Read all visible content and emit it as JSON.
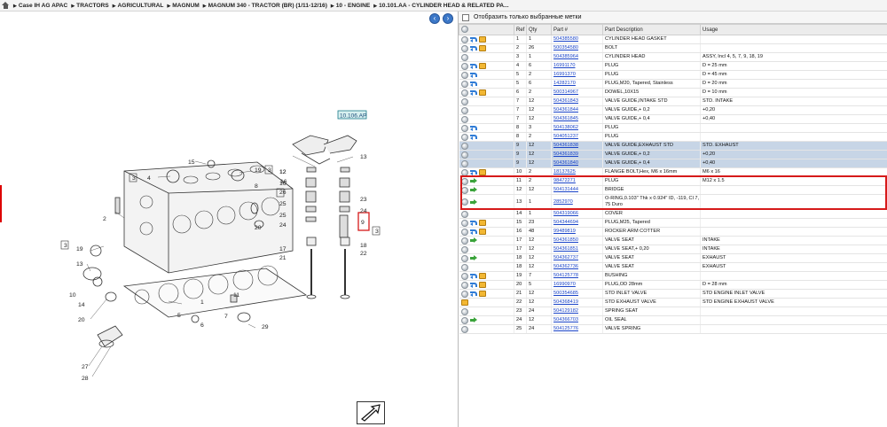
{
  "breadcrumb": [
    "Case IH AG APAC",
    "TRACTORS",
    "AGRICULTURAL",
    "MAGNUM",
    "MAGNUM 340 - TRACTOR (BR) (1/11-12/16)",
    "10 - ENGINE",
    "10.101.AA - CYLINDER HEAD & RELATED PA..."
  ],
  "toolbar": {
    "prev_icon": "left-arrow-icon",
    "next_icon": "right-arrow-icon"
  },
  "filter": {
    "label": "Отобразить только выбранные метки",
    "checked": false
  },
  "table": {
    "columns": [
      "",
      "Ref",
      "Qty",
      "Part #",
      "Part Description",
      "Usage"
    ],
    "rows": [
      {
        "icons": [
          "circle",
          "blue",
          "box"
        ],
        "ref": "1",
        "qty": "1",
        "part": "504385580",
        "desc": "CYLINDER HEAD GASKET",
        "usage": "",
        "selected": false
      },
      {
        "icons": [
          "circle",
          "blue",
          "box"
        ],
        "ref": "2",
        "qty": "26",
        "part": "500354580",
        "desc": "BOLT",
        "usage": "",
        "selected": false
      },
      {
        "icons": [
          "circle"
        ],
        "ref": "3",
        "qty": "1",
        "part": "504385964",
        "desc": "CYLINDER HEAD",
        "usage": "ASSY, Incl 4, 5, 7, 9, 18, 19",
        "selected": false
      },
      {
        "icons": [
          "circle",
          "blue",
          "box"
        ],
        "ref": "4",
        "qty": "6",
        "part": "16991170",
        "desc": "PLUG",
        "usage": "D = 25 mm",
        "selected": false
      },
      {
        "icons": [
          "circle",
          "blue"
        ],
        "ref": "5",
        "qty": "2",
        "part": "16991370",
        "desc": "PLUG",
        "usage": "D = 45 mm",
        "selected": false
      },
      {
        "icons": [
          "circle",
          "blue"
        ],
        "ref": "5",
        "qty": "6",
        "part": "14282170",
        "desc": "PLUG,M20, Tapered, Stainless",
        "usage": "D = 20 mm",
        "selected": false
      },
      {
        "icons": [
          "circle",
          "blue",
          "box"
        ],
        "ref": "6",
        "qty": "2",
        "part": "500314967",
        "desc": "DOWEL,10X15",
        "usage": "D = 10 mm",
        "selected": false
      },
      {
        "icons": [
          "circle"
        ],
        "ref": "7",
        "qty": "12",
        "part": "504361843",
        "desc": "VALVE GUIDE,INTAKE STD",
        "usage": "STD. INTAKE",
        "selected": false
      },
      {
        "icons": [
          "circle"
        ],
        "ref": "7",
        "qty": "12",
        "part": "504361844",
        "desc": "VALVE GUIDE,+ 0,2",
        "usage": "+0,20",
        "selected": false
      },
      {
        "icons": [
          "circle"
        ],
        "ref": "7",
        "qty": "12",
        "part": "504361845",
        "desc": "VALVE GUIDE,+ 0,4",
        "usage": "+0,40",
        "selected": false
      },
      {
        "icons": [
          "circle",
          "blue"
        ],
        "ref": "8",
        "qty": "3",
        "part": "504138062",
        "desc": "PLUG",
        "usage": "",
        "selected": false
      },
      {
        "icons": [
          "circle",
          "blue"
        ],
        "ref": "8",
        "qty": "2",
        "part": "504051237",
        "desc": "PLUG",
        "usage": "",
        "selected": false
      },
      {
        "icons": [
          "circle"
        ],
        "ref": "9",
        "qty": "12",
        "part": "504361838",
        "desc": "VALVE GUIDE,EXHAUST STD",
        "usage": "STD. EXHAUST",
        "selected": true
      },
      {
        "icons": [
          "circle"
        ],
        "ref": "9",
        "qty": "12",
        "part": "504361839",
        "desc": "VALVE GUIDE,+ 0,2",
        "usage": "+0,20",
        "selected": true
      },
      {
        "icons": [
          "circle"
        ],
        "ref": "9",
        "qty": "12",
        "part": "504361840",
        "desc": "VALVE GUIDE,+ 0,4",
        "usage": "+0,40",
        "selected": true
      },
      {
        "icons": [
          "circle",
          "blue",
          "box"
        ],
        "ref": "10",
        "qty": "2",
        "part": "18137625",
        "desc": "FLANGE BOLT,Hex, M6 x 16mm",
        "usage": "M6 x 16",
        "selected": false
      },
      {
        "icons": [
          "circle",
          "green"
        ],
        "ref": "11",
        "qty": "2",
        "part": "98472271",
        "desc": "PLUG",
        "usage": "M12 x 1.5",
        "selected": false
      },
      {
        "icons": [
          "circle",
          "green"
        ],
        "ref": "12",
        "qty": "12",
        "part": "504131444",
        "desc": "BRIDGE",
        "usage": "",
        "selected": false
      },
      {
        "icons": [
          "circle",
          "green"
        ],
        "ref": "13",
        "qty": "1",
        "part": "2852970",
        "desc": "O-RING,0.103\" Thk x 0.924\" ID, -119, Cl 7, 75 Duro",
        "usage": "",
        "selected": false,
        "tall": true
      },
      {
        "icons": [
          "circle"
        ],
        "ref": "14",
        "qty": "1",
        "part": "504319066",
        "desc": "COVER",
        "usage": "",
        "selected": false
      },
      {
        "icons": [
          "circle",
          "blue",
          "box"
        ],
        "ref": "15",
        "qty": "23",
        "part": "504344694",
        "desc": "PLUG,M25, Tapered",
        "usage": "",
        "selected": false
      },
      {
        "icons": [
          "circle",
          "blue",
          "box"
        ],
        "ref": "16",
        "qty": "48",
        "part": "99489819",
        "desc": "ROCKER ARM COTTER",
        "usage": "",
        "selected": false
      },
      {
        "icons": [
          "circle",
          "green"
        ],
        "ref": "17",
        "qty": "12",
        "part": "504361850",
        "desc": "VALVE SEAT",
        "usage": "INTAKE",
        "selected": false
      },
      {
        "icons": [
          "circle"
        ],
        "ref": "17",
        "qty": "12",
        "part": "504361851",
        "desc": "VALVE SEAT,+ 0,20",
        "usage": "INTAKE",
        "selected": false
      },
      {
        "icons": [
          "circle",
          "green"
        ],
        "ref": "18",
        "qty": "12",
        "part": "504362737",
        "desc": "VALVE SEAT",
        "usage": "EXHAUST",
        "selected": false
      },
      {
        "icons": [
          "circle"
        ],
        "ref": "18",
        "qty": "12",
        "part": "504362736",
        "desc": "VALVE SEAT",
        "usage": "EXHAUST",
        "selected": false
      },
      {
        "icons": [
          "circle",
          "blue",
          "box"
        ],
        "ref": "19",
        "qty": "7",
        "part": "504125778",
        "desc": "BUSHING",
        "usage": "",
        "selected": false
      },
      {
        "icons": [
          "circle",
          "blue",
          "box"
        ],
        "ref": "20",
        "qty": "5",
        "part": "16990970",
        "desc": "PLUG,OD 28mm",
        "usage": "D = 28 mm",
        "selected": false
      },
      {
        "icons": [
          "circle",
          "blue",
          "box"
        ],
        "ref": "21",
        "qty": "12",
        "part": "500354685",
        "desc": "STD INLET VALVE",
        "usage": "STD ENGINE INLET VALVE",
        "selected": false
      },
      {
        "icons": [
          "box"
        ],
        "ref": "22",
        "qty": "12",
        "part": "504368419",
        "desc": "STD EXHAUST VALVE",
        "usage": "STD ENGINE EXHAUST VALVE",
        "selected": false
      },
      {
        "icons": [
          "circle"
        ],
        "ref": "23",
        "qty": "24",
        "part": "504129182",
        "desc": "SPRING SEAT",
        "usage": "",
        "selected": false
      },
      {
        "icons": [
          "circle",
          "green"
        ],
        "ref": "24",
        "qty": "12",
        "part": "504366703",
        "desc": "OIL SEAL",
        "usage": "",
        "selected": false
      },
      {
        "icons": [
          "circle"
        ],
        "ref": "25",
        "qty": "24",
        "part": "504125776",
        "desc": "VALVE SPRING",
        "usage": "",
        "selected": false
      }
    ]
  },
  "drawing": {
    "tag": "10.106.AP",
    "callouts": [
      "15",
      "4",
      "3",
      "19",
      "3",
      "16",
      "12",
      "13",
      "2",
      "8",
      "26",
      "25",
      "24",
      "20",
      "17",
      "21",
      "23",
      "24",
      "9",
      "3",
      "18",
      "22",
      "12",
      "16",
      "25",
      "3",
      "19",
      "13",
      "10",
      "14",
      "20",
      "1",
      "5",
      "6",
      "11",
      "29",
      "27",
      "28",
      "7"
    ]
  }
}
